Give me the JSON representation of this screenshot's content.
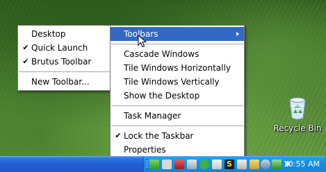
{
  "desktop": {
    "recycle_bin_label": "Recycle Bin"
  },
  "context_menu": {
    "items": [
      {
        "label": "Toolbars",
        "highlighted": true,
        "has_submenu": true
      },
      {
        "label": "Cascade Windows"
      },
      {
        "label": "Tile Windows Horizontally"
      },
      {
        "label": "Tile Windows Vertically"
      },
      {
        "label": "Show the Desktop"
      },
      {
        "label": "Task Manager"
      },
      {
        "label": "Lock the Taskbar",
        "checked": true,
        "check_mark": "✔"
      },
      {
        "label": "Properties"
      }
    ]
  },
  "toolbars_submenu": {
    "items": [
      {
        "label": "Desktop"
      },
      {
        "label": "Quick Launch",
        "checked": true,
        "check_mark": "✔"
      },
      {
        "label": "Brutus Toolbar",
        "checked": true,
        "check_mark": "✔"
      },
      {
        "label": "New Toolbar..."
      }
    ]
  },
  "taskbar": {
    "clock": "10:55 AM",
    "tray_icons": [
      "network-icon",
      "bluetooth-icon",
      "shield-icon",
      "security-icon",
      "messenger-icon",
      "chat-icon",
      "s-icon",
      "flag-icon",
      "volume-icon",
      "power-icon",
      "sync-icon",
      "display-icon",
      "printer-icon",
      "alert-icon",
      "globe-icon"
    ]
  },
  "colors": {
    "selection": "#316ac5",
    "taskbar": "#225ed4",
    "tray": "#1690e3"
  }
}
